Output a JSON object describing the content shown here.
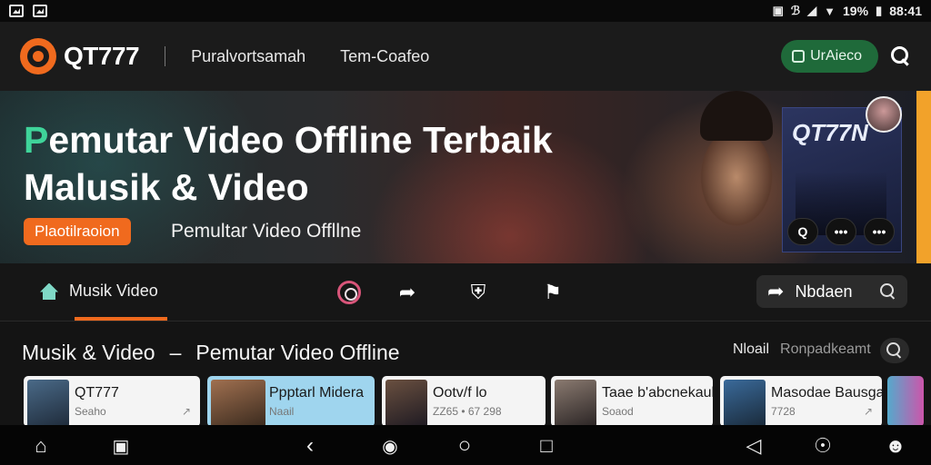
{
  "status_bar": {
    "battery": "19%",
    "time": "88:41"
  },
  "header": {
    "brand": "QT777",
    "nav": [
      "Puralvortsamah",
      "Tem-Coafeo"
    ],
    "cta_label": "UrAieco"
  },
  "hero": {
    "title_accent": "P",
    "title_line1": "emutar Video Offline Terbaik",
    "title_line2": "Malusik & Video",
    "pill": "Plaotilraoion",
    "subtitle": "Pemultar Video Offllne",
    "poster_title": "QT77N",
    "controls": [
      "Q",
      "•••",
      "•••"
    ]
  },
  "tabs": {
    "active_label": "Musik Video",
    "share_label": "Nbdaen"
  },
  "section": {
    "title_left": "Musik & Video",
    "separator": "–",
    "title_right": "Pemutar Video Offline",
    "link_a": "Nloail",
    "link_b": "Ronpadkeamt"
  },
  "cards": [
    {
      "title": "QT777",
      "sub": "Seaho"
    },
    {
      "title": "Ppptarl Midera",
      "sub": "Naail"
    },
    {
      "title": "Ootv/f lo",
      "sub": "ZZ65 • 67 298"
    },
    {
      "title": "Taae b'abcnekaul",
      "sub": "Soaod"
    },
    {
      "title": "Masodae Bausgar",
      "sub": "7728"
    }
  ],
  "colors": {
    "accent": "#f06a1e",
    "cta_green": "#1f6a3a",
    "hero_accent": "#3fd49a"
  }
}
